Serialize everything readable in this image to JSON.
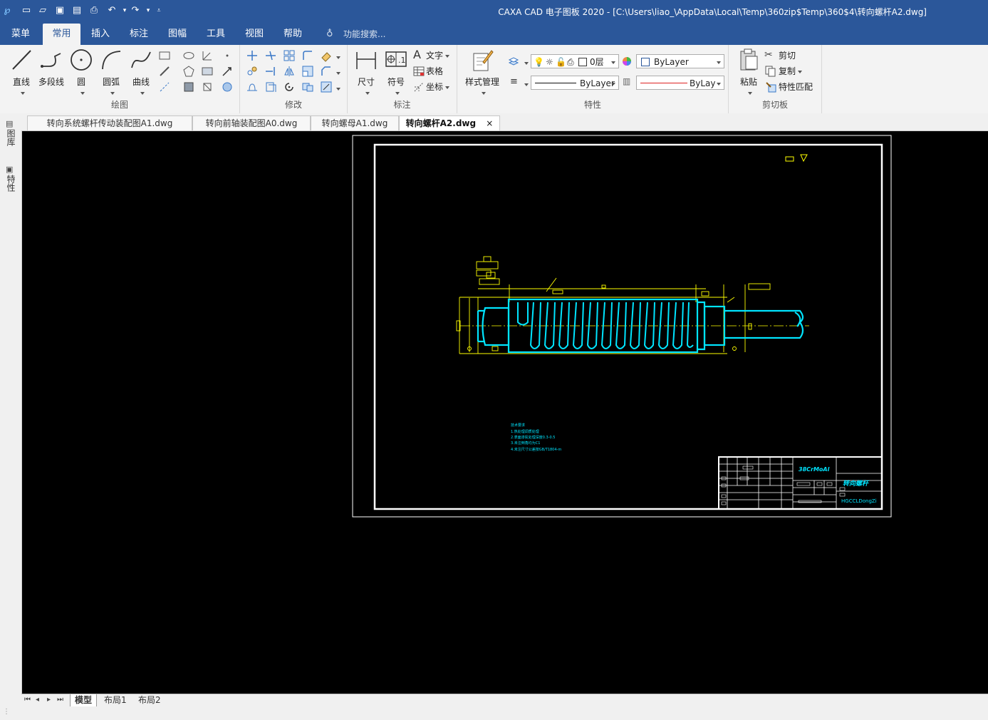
{
  "window": {
    "title": "CAXA CAD 电子图板 2020 - [C:\\Users\\liao_\\AppData\\Local\\Temp\\360zip$Temp\\360$4\\转向螺杆A2.dwg]"
  },
  "menu": {
    "items": [
      "菜单",
      "常用",
      "插入",
      "标注",
      "图幅",
      "工具",
      "视图",
      "帮助"
    ],
    "active": "常用",
    "search_placeholder": "功能搜索..."
  },
  "ribbon": {
    "draw": {
      "label": "绘图",
      "line": "直线",
      "polyline": "多段线",
      "circle": "圆",
      "arc": "圆弧",
      "curve": "曲线"
    },
    "modify": {
      "label": "修改"
    },
    "annotate": {
      "label": "标注",
      "dimension": "尺寸",
      "symbol": "符号",
      "text": "文字",
      "table": "表格",
      "coordinate": "坐标"
    },
    "style": {
      "label": "样式管理"
    },
    "properties": {
      "label": "特性",
      "layer": "0层",
      "color": "ByLayer",
      "linetype": "ByLayer",
      "lineweight": "ByLaye"
    },
    "clipboard": {
      "label": "剪切板",
      "paste": "粘贴",
      "cut": "剪切",
      "copy": "复制",
      "match": "特性匹配"
    }
  },
  "side_panel": {
    "tabs": [
      "图库",
      "特性"
    ]
  },
  "documents": {
    "tabs": [
      "转向系统螺杆传动装配图A1.dwg",
      "转向前轴装配图A0.dwg",
      "转向螺母A1.dwg",
      "转向螺杆A2.dwg"
    ],
    "active_index": 3,
    "close_glyph": "×"
  },
  "drawing": {
    "title_block": {
      "material": "38CrMoAl",
      "part_name": "转向螺杆",
      "code": "HGCCLDongZi"
    },
    "tech_notes": [
      "技术要求",
      "1.热处理调质处理",
      "2.表面渗氮处理深度0.3-0.5",
      "3.未注倒角均为C1",
      "4.未注尺寸公差按GB/T1804-m"
    ]
  },
  "layouts": {
    "tabs": [
      "模型",
      "布局1",
      "布局2"
    ],
    "active": "模型"
  },
  "colors": {
    "ribbon_blue": "#2b579a",
    "canvas": "#000000",
    "outline": "#00e5ff",
    "dimension": "#ffff00",
    "paper_border": "#ffffff"
  }
}
